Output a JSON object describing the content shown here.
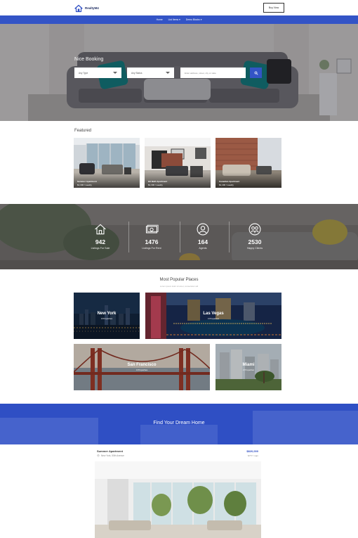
{
  "brand": {
    "name": "RealtyM4"
  },
  "header": {
    "buy_label": "Buy Now"
  },
  "nav": {
    "items": [
      "Home",
      "List Items",
      "Demo Blocks"
    ]
  },
  "hero": {
    "title": "Nice Booking",
    "type_select": "Any Type",
    "status_select": "Any Status",
    "search_placeholder": "Enter address, street, city or state"
  },
  "featured": {
    "title": "Featured",
    "cards": [
      {
        "name": "Summer Apartment",
        "price": "$1,300 / weekly"
      },
      {
        "name": "Hit Bath Apartment",
        "price": "$1,300 / weekly"
      },
      {
        "name": "Canadian Apartment",
        "price": "$1,400 / weekly"
      }
    ]
  },
  "stats": [
    {
      "value": "942",
      "label": "Listings For Sale",
      "icon": "house-icon"
    },
    {
      "value": "1476",
      "label": "Listings For Rent",
      "icon": "money-icon"
    },
    {
      "value": "164",
      "label": "Agents",
      "icon": "person-icon"
    },
    {
      "value": "2530",
      "label": "Happy Clients",
      "icon": "handshake-icon"
    }
  ],
  "popular": {
    "title": "Most Popular Places",
    "subtitle": "Lorem ipsum dolor sit amet, consectetur adi",
    "places": [
      {
        "name": "New York",
        "count": "3 Properties"
      },
      {
        "name": "Las Vegas",
        "count": "4 Properties"
      },
      {
        "name": "San Francisco",
        "count": "4 Properties"
      },
      {
        "name": "Miami",
        "count": "2 Properties"
      }
    ]
  },
  "dream": {
    "title": "Find Your Dream Home"
  },
  "listing": {
    "title": "Summer Apartment",
    "location": "New York, 50th Avenue",
    "price": "$820,000",
    "unit": "$777 / sqm"
  },
  "colors": {
    "accent": "#3354c6",
    "brand_dark": "#1f2d63"
  }
}
